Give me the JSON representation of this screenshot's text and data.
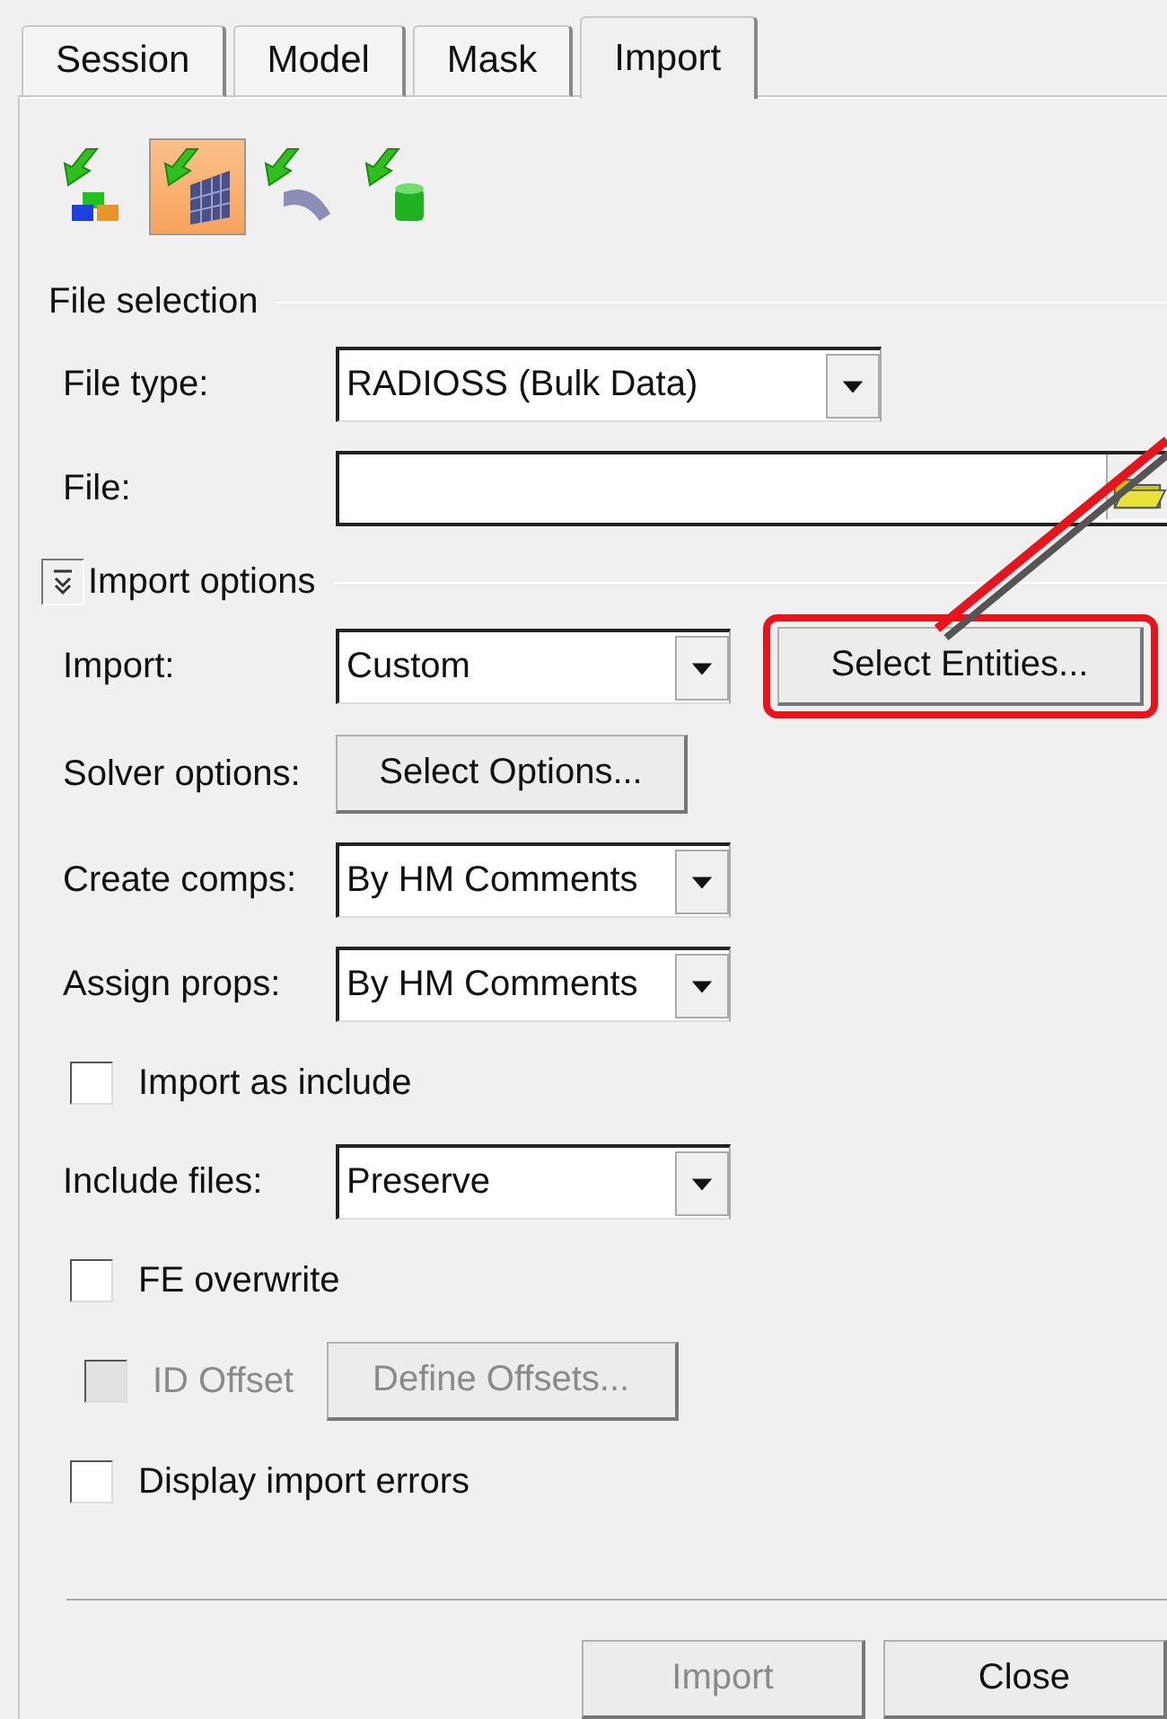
{
  "tabs": [
    {
      "label": "Session",
      "selected": false
    },
    {
      "label": "Model",
      "selected": false
    },
    {
      "label": "Mask",
      "selected": false
    },
    {
      "label": "Import",
      "selected": true
    }
  ],
  "toolbar": [
    {
      "kind": "components",
      "selected": false
    },
    {
      "kind": "mesh",
      "selected": true
    },
    {
      "kind": "surface",
      "selected": false
    },
    {
      "kind": "cylinder",
      "selected": false
    }
  ],
  "file_selection": {
    "title": "File selection",
    "file_type": {
      "label": "File type:",
      "value": "RADIOSS (Bulk Data)"
    },
    "file": {
      "label": "File:"
    }
  },
  "import_options": {
    "title": "Import options",
    "expanded": true,
    "rows": [
      {
        "kind": "select",
        "label": "Import:",
        "value": "Custom",
        "button": {
          "label": "Select Entities...",
          "highlighted": true,
          "disabled": false
        }
      },
      {
        "kind": "button",
        "label": "Solver options:",
        "button": {
          "label": "Select Options...",
          "highlighted": false,
          "disabled": false
        }
      },
      {
        "kind": "select",
        "label": "Create comps:",
        "value": "By HM Comments"
      },
      {
        "kind": "select",
        "label": "Assign props:",
        "value": "By HM Comments"
      },
      {
        "kind": "checkbox",
        "label": "Import as include",
        "checked": false,
        "disabled": false
      },
      {
        "kind": "select",
        "label": "Include files:",
        "value": "Preserve"
      },
      {
        "kind": "checkbox",
        "label": "FE overwrite",
        "checked": false,
        "disabled": false
      },
      {
        "kind": "checkbox",
        "label": "ID Offset",
        "checked": false,
        "disabled": true,
        "button": {
          "label": "Define Offsets...",
          "highlighted": false,
          "disabled": true
        }
      },
      {
        "kind": "checkbox",
        "label": "Display import errors",
        "checked": false,
        "disabled": false
      }
    ]
  },
  "footer_buttons": [
    {
      "label": "Import",
      "disabled": true
    },
    {
      "label": "Close",
      "disabled": false
    }
  ]
}
